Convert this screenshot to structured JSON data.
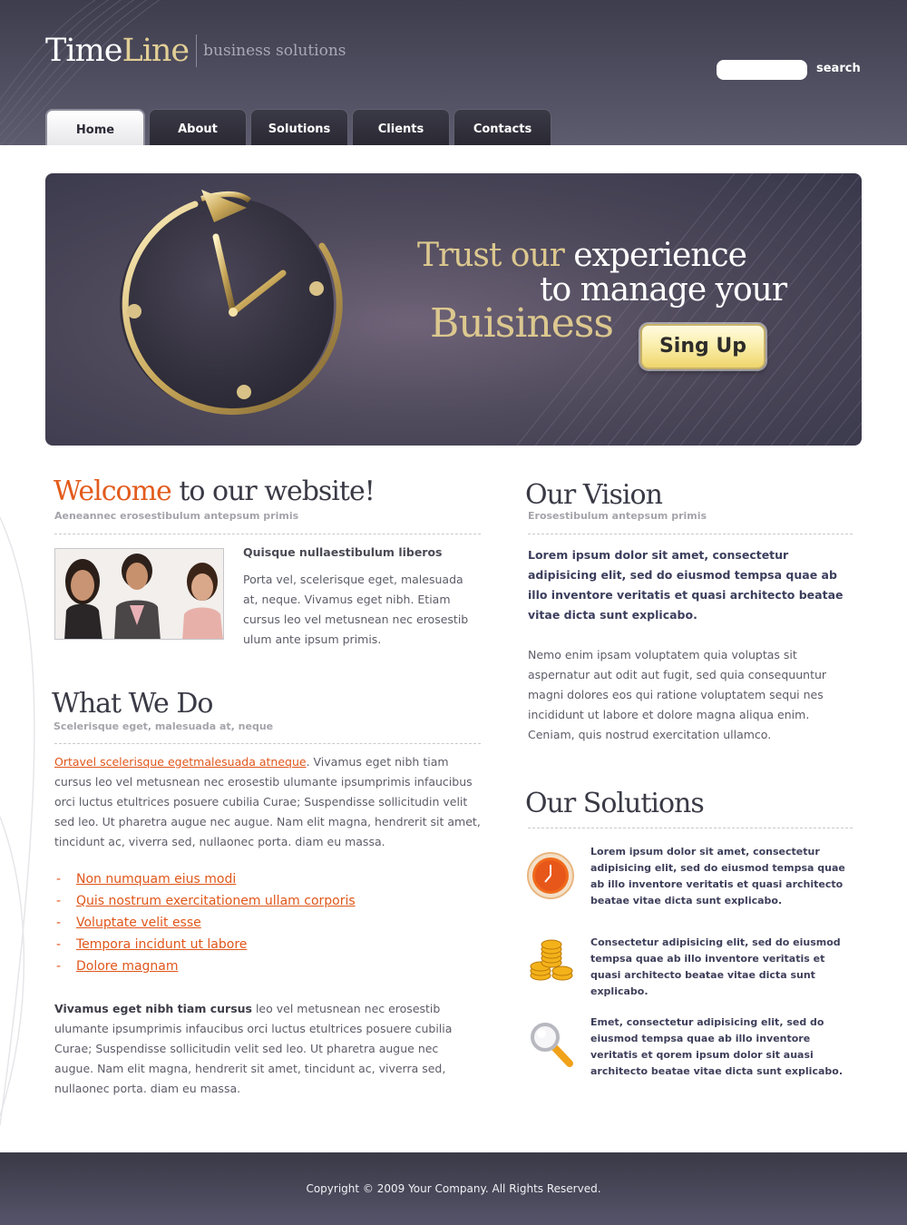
{
  "brand": {
    "name_part1": "Time",
    "name_part2": "Line",
    "tagline": "business solutions"
  },
  "search": {
    "placeholder": "",
    "button_label": "search"
  },
  "nav": {
    "tabs": [
      {
        "label": "Home",
        "active": true
      },
      {
        "label": "About"
      },
      {
        "label": "Solutions"
      },
      {
        "label": "Clients"
      },
      {
        "label": "Contacts"
      }
    ]
  },
  "banner": {
    "line1_accent": "Trust our",
    "line1_rest": " experience",
    "line2": "to manage your",
    "line3": "Buisiness",
    "signup_label": "Sing Up"
  },
  "welcome": {
    "title_accent": "Welcome",
    "title_rest": " to our website!",
    "subtitle": "Aeneannec erosestibulum antepsum primis",
    "item_title": "Quisque nullaestibulum liberos",
    "item_text": "Porta vel, scelerisque eget, malesuada at, neque. Vivamus eget nibh. Etiam cursus leo vel metusnean nec erosestib ulum ante ipsum primis."
  },
  "what_we_do": {
    "title": "What We Do",
    "subtitle": "Scelerisque eget, malesuada at, neque",
    "intro_link": "Ortavel scelerisque egetmalesuada atneque",
    "intro_text": ". Vivamus eget nibh tiam cursus leo vel metusnean nec erosestib ulumante ipsumprimis infaucibus orci luctus etultrices posuere cubilia Curae; Suspendisse sollicitudin velit sed leo. Ut pharetra augue nec augue. Nam elit magna, hendrerit sit amet, tincidunt ac, viverra sed, nullaonec porta. diam eu massa.",
    "links": [
      "Non numquam eius modi",
      "Quis nostrum exercitationem ullam corporis",
      "Voluptate velit esse",
      "Tempora incidunt ut labore",
      "Dolore magnam"
    ],
    "closing_bold": "Vivamus eget nibh tiam cursus",
    "closing_text": " leo vel metusnean nec erosestib ulumante ipsumprimis infaucibus orci luctus etultrices posuere cubilia Curae; Suspendisse sollicitudin velit sed leo. Ut pharetra augue nec augue. Nam elit magna, hendrerit sit amet, tincidunt ac, viverra sed, nullaonec porta. diam eu massa."
  },
  "vision": {
    "title": "Our Vision",
    "subtitle": "Erosestibulum antepsum primis",
    "lead": "Lorem ipsum dolor sit amet, consectetur adipisicing elit, sed do eiusmod tempsa quae ab illo inventore veritatis et quasi architecto beatae vitae dicta sunt explicabo.",
    "text": "Nemo enim ipsam voluptatem quia voluptas sit aspernatur aut odit aut fugit, sed quia consequuntur magni dolores eos qui ratione voluptatem sequi nes incididunt ut labore et dolore magna aliqua enim. Ceniam, quis nostrud exercitation ullamco."
  },
  "solutions": {
    "title": "Our Solutions",
    "items": [
      {
        "icon": "clock-icon",
        "text": "Lorem ipsum dolor sit amet, consectetur adipisicing elit, sed do eiusmod tempsa quae ab illo inventore veritatis et quasi architecto beatae vitae dicta sunt explicabo."
      },
      {
        "icon": "coins-icon",
        "text": "Consectetur adipisicing elit, sed do eiusmod tempsa quae ab illo inventore veritatis et quasi architecto beatae vitae dicta sunt explicabo."
      },
      {
        "icon": "magnifier-icon",
        "text": "Emet, consectetur adipisicing elit, sed do eiusmod tempsa quae ab illo inventore veritatis et qorem ipsum dolor sit auasi architecto beatae vitae dicta sunt explicabo."
      }
    ]
  },
  "footer": {
    "copyright": "Copyright © 2009 Your Company. All Rights Reserved."
  },
  "colors": {
    "accent": "#e25b1c",
    "gold": "#dcc88f",
    "header_bg": "#4a4958",
    "text_dark": "#3a3a46"
  }
}
